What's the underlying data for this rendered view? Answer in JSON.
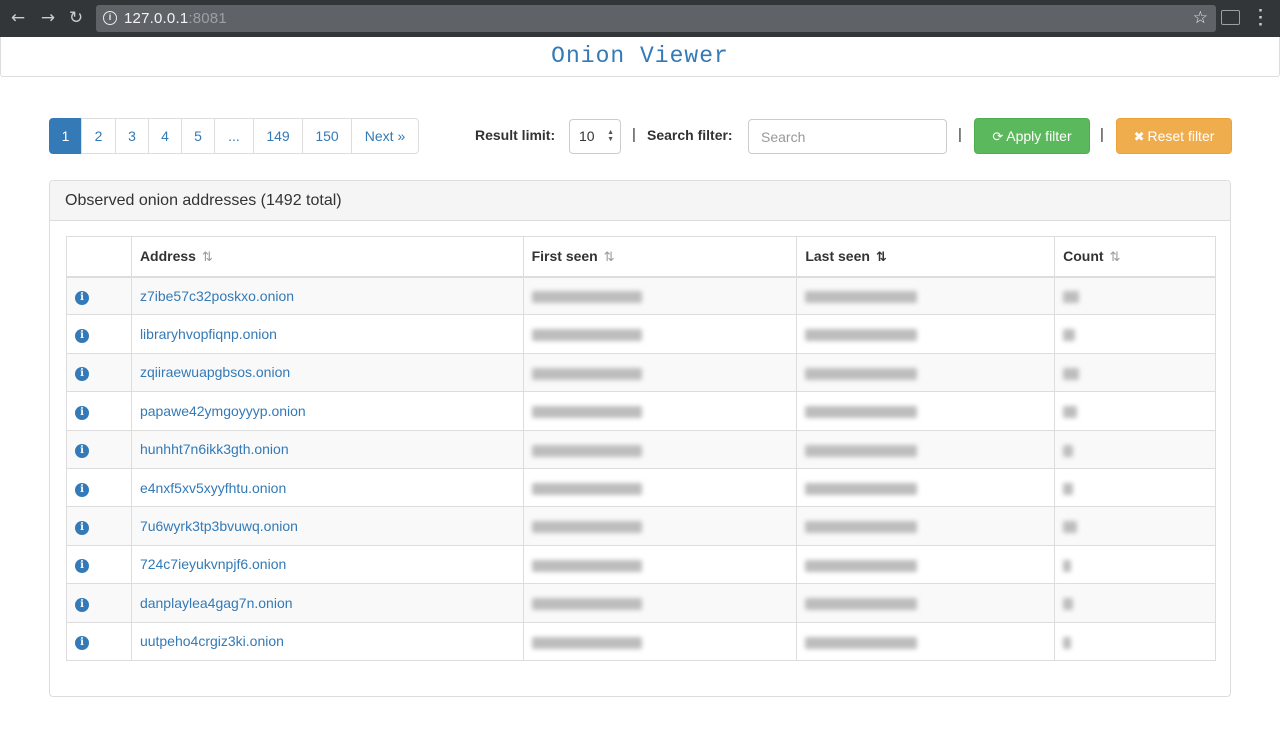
{
  "browser": {
    "url_host": "127.0.0.1",
    "url_port": ":8081"
  },
  "header": {
    "title": "Onion Viewer"
  },
  "pagination": {
    "pages": [
      {
        "label": "1",
        "active": true
      },
      {
        "label": "2"
      },
      {
        "label": "3"
      },
      {
        "label": "4"
      },
      {
        "label": "5"
      },
      {
        "label": "..."
      },
      {
        "label": "149"
      },
      {
        "label": "150"
      },
      {
        "label": "Next »"
      }
    ]
  },
  "filters": {
    "result_limit_label": "Result limit:",
    "result_limit_value": "10",
    "search_label": "Search filter:",
    "search_placeholder": "Search",
    "search_value": "",
    "separator": "|",
    "apply_label": "Apply filter",
    "reset_label": "Reset filter"
  },
  "panel": {
    "heading": "Observed onion addresses (1492 total)"
  },
  "table": {
    "columns": [
      "",
      "Address",
      "First seen",
      "Last seen",
      "Count"
    ],
    "sorted_column": "Last seen",
    "rows": [
      {
        "address": "z7ibe57c32poskxo.onion"
      },
      {
        "address": "libraryhvopfiqnp.onion"
      },
      {
        "address": "zqiiraewuapgbsos.onion"
      },
      {
        "address": "papawe42ymgoyyyp.onion"
      },
      {
        "address": "hunhht7n6ikk3gth.onion"
      },
      {
        "address": "e4nxf5xv5xyyfhtu.onion"
      },
      {
        "address": "7u6wyrk3tp3bvuwq.onion"
      },
      {
        "address": "724c7ieyukvnpjf6.onion"
      },
      {
        "address": "danplaylea4gag7n.onion"
      },
      {
        "address": "uutpeho4crgiz3ki.onion"
      }
    ]
  },
  "colors": {
    "link": "#337ab7",
    "apply": "#5cb85c",
    "reset": "#f0ad4e"
  },
  "icons": {
    "info": "info-circle-icon",
    "sort": "sort-icon",
    "refresh": "refresh-icon",
    "reset": "times-icon"
  }
}
